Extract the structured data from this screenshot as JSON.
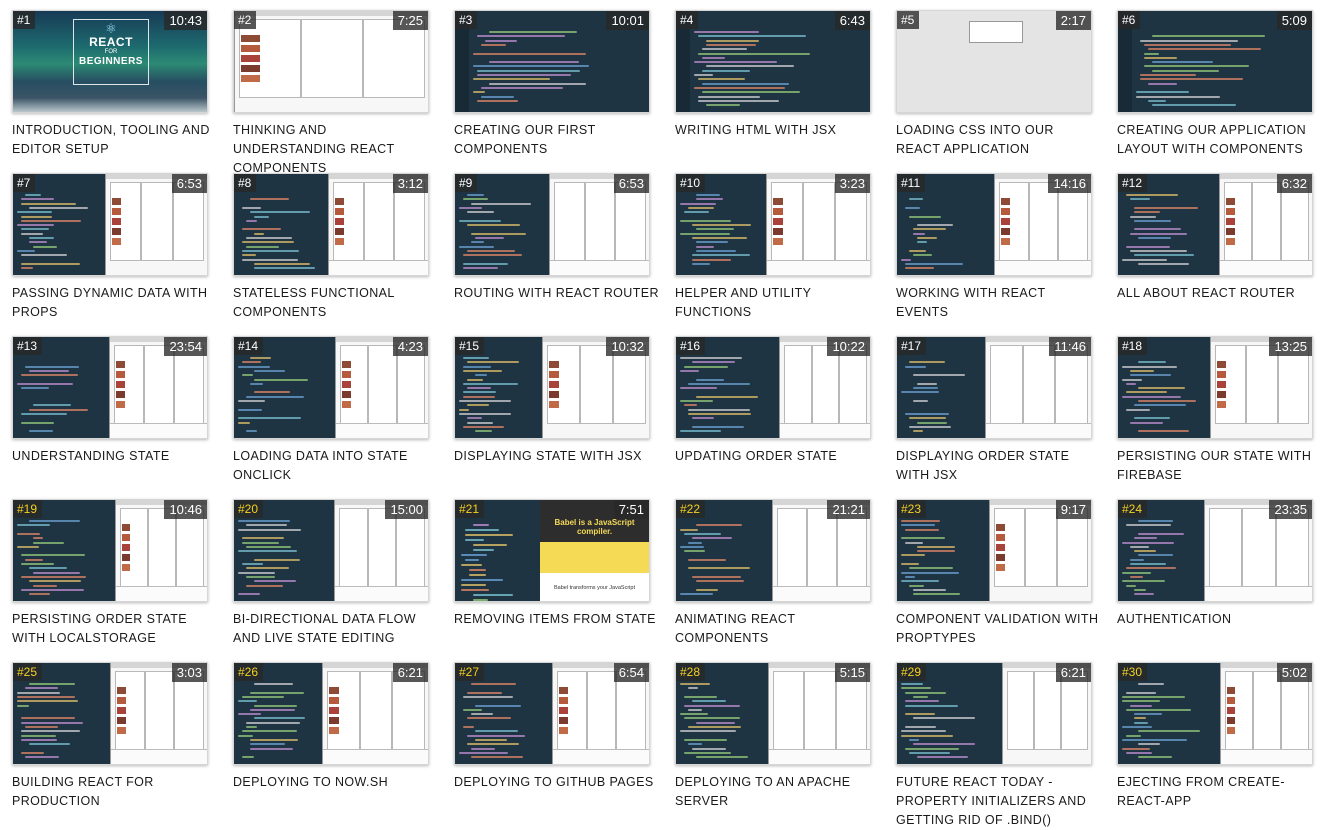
{
  "colors": {
    "editor_bg": "#1f3443",
    "number_badge_text": "#ffffff",
    "number_badge_highlight": "#f5d020",
    "duration_text": "#ffffff",
    "title_text": "#1a1a1a"
  },
  "intro_logo": {
    "word1": "REACT",
    "word2": "FOR",
    "word3": "BEGINNERS"
  },
  "babel_thumb": {
    "headline": "Babel is a JavaScript compiler.",
    "subline": "Babel transforms your JavaScript"
  },
  "videos": [
    {
      "number": "#1",
      "duration": "10:43",
      "title": "INTRODUCTION, TOOLING AND EDITOR SETUP",
      "thumb": "intro",
      "badge": "white"
    },
    {
      "number": "#2",
      "duration": "7:25",
      "title": "THINKING AND UNDERSTANDING REACT COMPONENTS",
      "thumb": "app",
      "badge": "white"
    },
    {
      "number": "#3",
      "duration": "10:01",
      "title": "CREATING OUR FIRST COMPONENTS",
      "thumb": "code",
      "badge": "white"
    },
    {
      "number": "#4",
      "duration": "6:43",
      "title": "WRITING HTML WITH JSX",
      "thumb": "code",
      "badge": "white"
    },
    {
      "number": "#5",
      "duration": "2:17",
      "title": "LOADING CSS INTO OUR REACT APPLICATION",
      "thumb": "light",
      "badge": "white"
    },
    {
      "number": "#6",
      "duration": "5:09",
      "title": "CREATING OUR APPLICATION LAYOUT WITH COMPONENTS",
      "thumb": "code",
      "badge": "white"
    },
    {
      "number": "#7",
      "duration": "6:53",
      "title": "PASSING DYNAMIC DATA WITH PROPS",
      "thumb": "split",
      "badge": "white"
    },
    {
      "number": "#8",
      "duration": "3:12",
      "title": "STATELESS FUNCTIONAL COMPONENTS",
      "thumb": "split",
      "badge": "white"
    },
    {
      "number": "#9",
      "duration": "6:53",
      "title": "ROUTING WITH REACT ROUTER",
      "thumb": "split",
      "badge": "white"
    },
    {
      "number": "#10",
      "duration": "3:23",
      "title": "HELPER AND UTILITY FUNCTIONS",
      "thumb": "split",
      "badge": "white"
    },
    {
      "number": "#11",
      "duration": "14:16",
      "title": "WORKING WITH REACT EVENTS",
      "thumb": "split",
      "badge": "white"
    },
    {
      "number": "#12",
      "duration": "6:32",
      "title": "ALL ABOUT REACT ROUTER",
      "thumb": "split",
      "badge": "white"
    },
    {
      "number": "#13",
      "duration": "23:54",
      "title": "UNDERSTANDING STATE",
      "thumb": "split",
      "badge": "white"
    },
    {
      "number": "#14",
      "duration": "4:23",
      "title": "LOADING DATA INTO STATE ONCLICK",
      "thumb": "split",
      "badge": "white"
    },
    {
      "number": "#15",
      "duration": "10:32",
      "title": "DISPLAYING STATE WITH JSX",
      "thumb": "split",
      "badge": "white"
    },
    {
      "number": "#16",
      "duration": "10:22",
      "title": "UPDATING ORDER STATE",
      "thumb": "split",
      "badge": "white"
    },
    {
      "number": "#17",
      "duration": "11:46",
      "title": "DISPLAYING ORDER STATE WITH JSX",
      "thumb": "split",
      "badge": "white"
    },
    {
      "number": "#18",
      "duration": "13:25",
      "title": "PERSISTING OUR STATE WITH FIREBASE",
      "thumb": "split",
      "badge": "white"
    },
    {
      "number": "#19",
      "duration": "10:46",
      "title": "PERSISTING ORDER STATE WITH LOCALSTORAGE",
      "thumb": "split",
      "badge": "yellow"
    },
    {
      "number": "#20",
      "duration": "15:00",
      "title": "BI-DIRECTIONAL DATA FLOW AND LIVE STATE EDITING",
      "thumb": "split",
      "badge": "yellow"
    },
    {
      "number": "#21",
      "duration": "7:51",
      "title": "REMOVING ITEMS FROM STATE",
      "thumb": "babel",
      "badge": "yellow"
    },
    {
      "number": "#22",
      "duration": "21:21",
      "title": "ANIMATING REACT COMPONENTS",
      "thumb": "split",
      "badge": "yellow"
    },
    {
      "number": "#23",
      "duration": "9:17",
      "title": "COMPONENT VALIDATION WITH PROPTYPES",
      "thumb": "split",
      "badge": "yellow"
    },
    {
      "number": "#24",
      "duration": "23:35",
      "title": "AUTHENTICATION",
      "thumb": "split",
      "badge": "yellow"
    },
    {
      "number": "#25",
      "duration": "3:03",
      "title": "BUILDING REACT FOR PRODUCTION",
      "thumb": "split",
      "badge": "yellow"
    },
    {
      "number": "#26",
      "duration": "6:21",
      "title": "DEPLOYING TO NOW.SH",
      "thumb": "split",
      "badge": "yellow"
    },
    {
      "number": "#27",
      "duration": "6:54",
      "title": "DEPLOYING TO GITHUB PAGES",
      "thumb": "split",
      "badge": "yellow"
    },
    {
      "number": "#28",
      "duration": "5:15",
      "title": "DEPLOYING TO AN APACHE SERVER",
      "thumb": "split",
      "badge": "yellow"
    },
    {
      "number": "#29",
      "duration": "6:21",
      "title": "FUTURE REACT TODAY - PROPERTY INITIALIZERS AND GETTING RID OF .BIND()",
      "thumb": "split",
      "badge": "yellow"
    },
    {
      "number": "#30",
      "duration": "5:02",
      "title": "EJECTING FROM CREATE-REACT-APP",
      "thumb": "split",
      "badge": "yellow"
    }
  ]
}
